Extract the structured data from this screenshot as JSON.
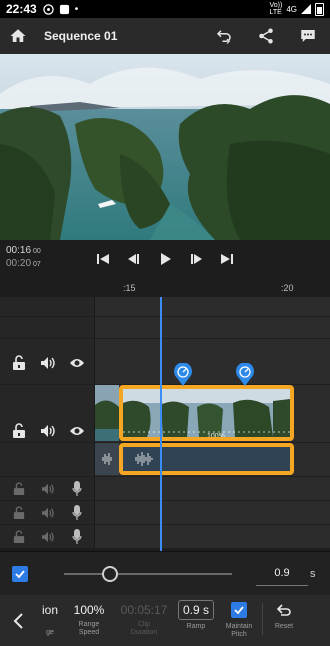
{
  "status": {
    "time": "22:43",
    "net_top": "Vo))",
    "net_bottom": "LTE",
    "signal": "4G"
  },
  "appbar": {
    "title": "Sequence 01",
    "icons": [
      "home-icon",
      "undo-icon",
      "share-icon",
      "comment-icon"
    ]
  },
  "timecode": {
    "current": "00:16",
    "current_frames": "00",
    "duration": "00:20",
    "duration_frames": "07"
  },
  "ruler": {
    "label_1": ":15",
    "label_2": ":20"
  },
  "clip": {
    "speed_percent": "100%"
  },
  "speed": {
    "value": "0.9",
    "unit": "s",
    "ramp_enabled": true
  },
  "toolbar": {
    "partial_label": "ion",
    "partial_sub": "ge",
    "range_speed_value": "100%",
    "range_speed_label_1": "Range",
    "range_speed_label_2": "Speed",
    "clip_duration_value": "00:05:17",
    "clip_duration_label_1": "Clip",
    "clip_duration_label_2": "Duration",
    "ramp_value": "0.9 s",
    "ramp_label": "Ramp",
    "maintain_pitch_label_1": "Maintain",
    "maintain_pitch_label_2": "Pitch",
    "reset_label": "Reset"
  },
  "colors": {
    "accent": "#2d7be5",
    "selection": "#f5a623",
    "playhead": "#3b8cf5"
  }
}
